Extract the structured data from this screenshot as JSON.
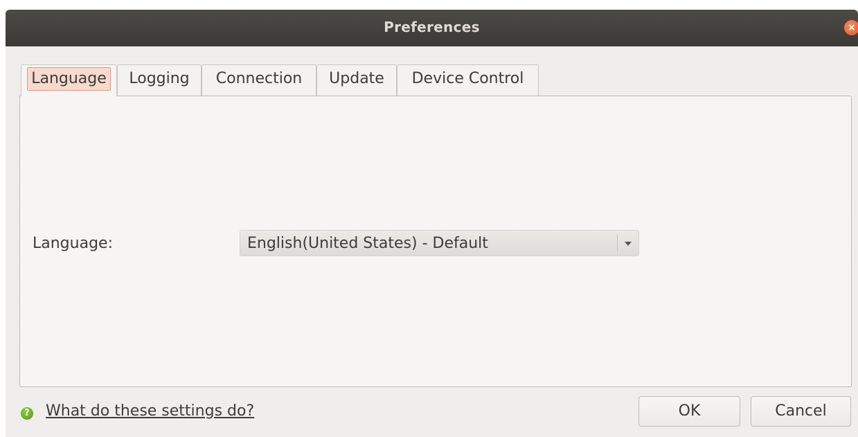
{
  "window": {
    "title": "Preferences",
    "close_glyph": "×"
  },
  "tabs": [
    {
      "label": "Language",
      "active": true
    },
    {
      "label": "Logging",
      "active": false
    },
    {
      "label": "Connection",
      "active": false
    },
    {
      "label": "Update",
      "active": false
    },
    {
      "label": "Device Control",
      "active": false
    }
  ],
  "language_panel": {
    "label": "Language:",
    "selected_value": "English(United States) - Default"
  },
  "footer": {
    "help_icon_glyph": "?",
    "help_link": "What do these settings do?",
    "ok_label": "OK",
    "cancel_label": "Cancel"
  },
  "colors": {
    "titlebar": "#3f3e3a",
    "close_button": "#e9602f",
    "active_tab_highlight": "#f7d9cd",
    "help_icon": "#5aa51c"
  },
  "icons": {
    "close": "close-icon",
    "dropdown": "chevron-down-icon",
    "help": "help-icon"
  }
}
